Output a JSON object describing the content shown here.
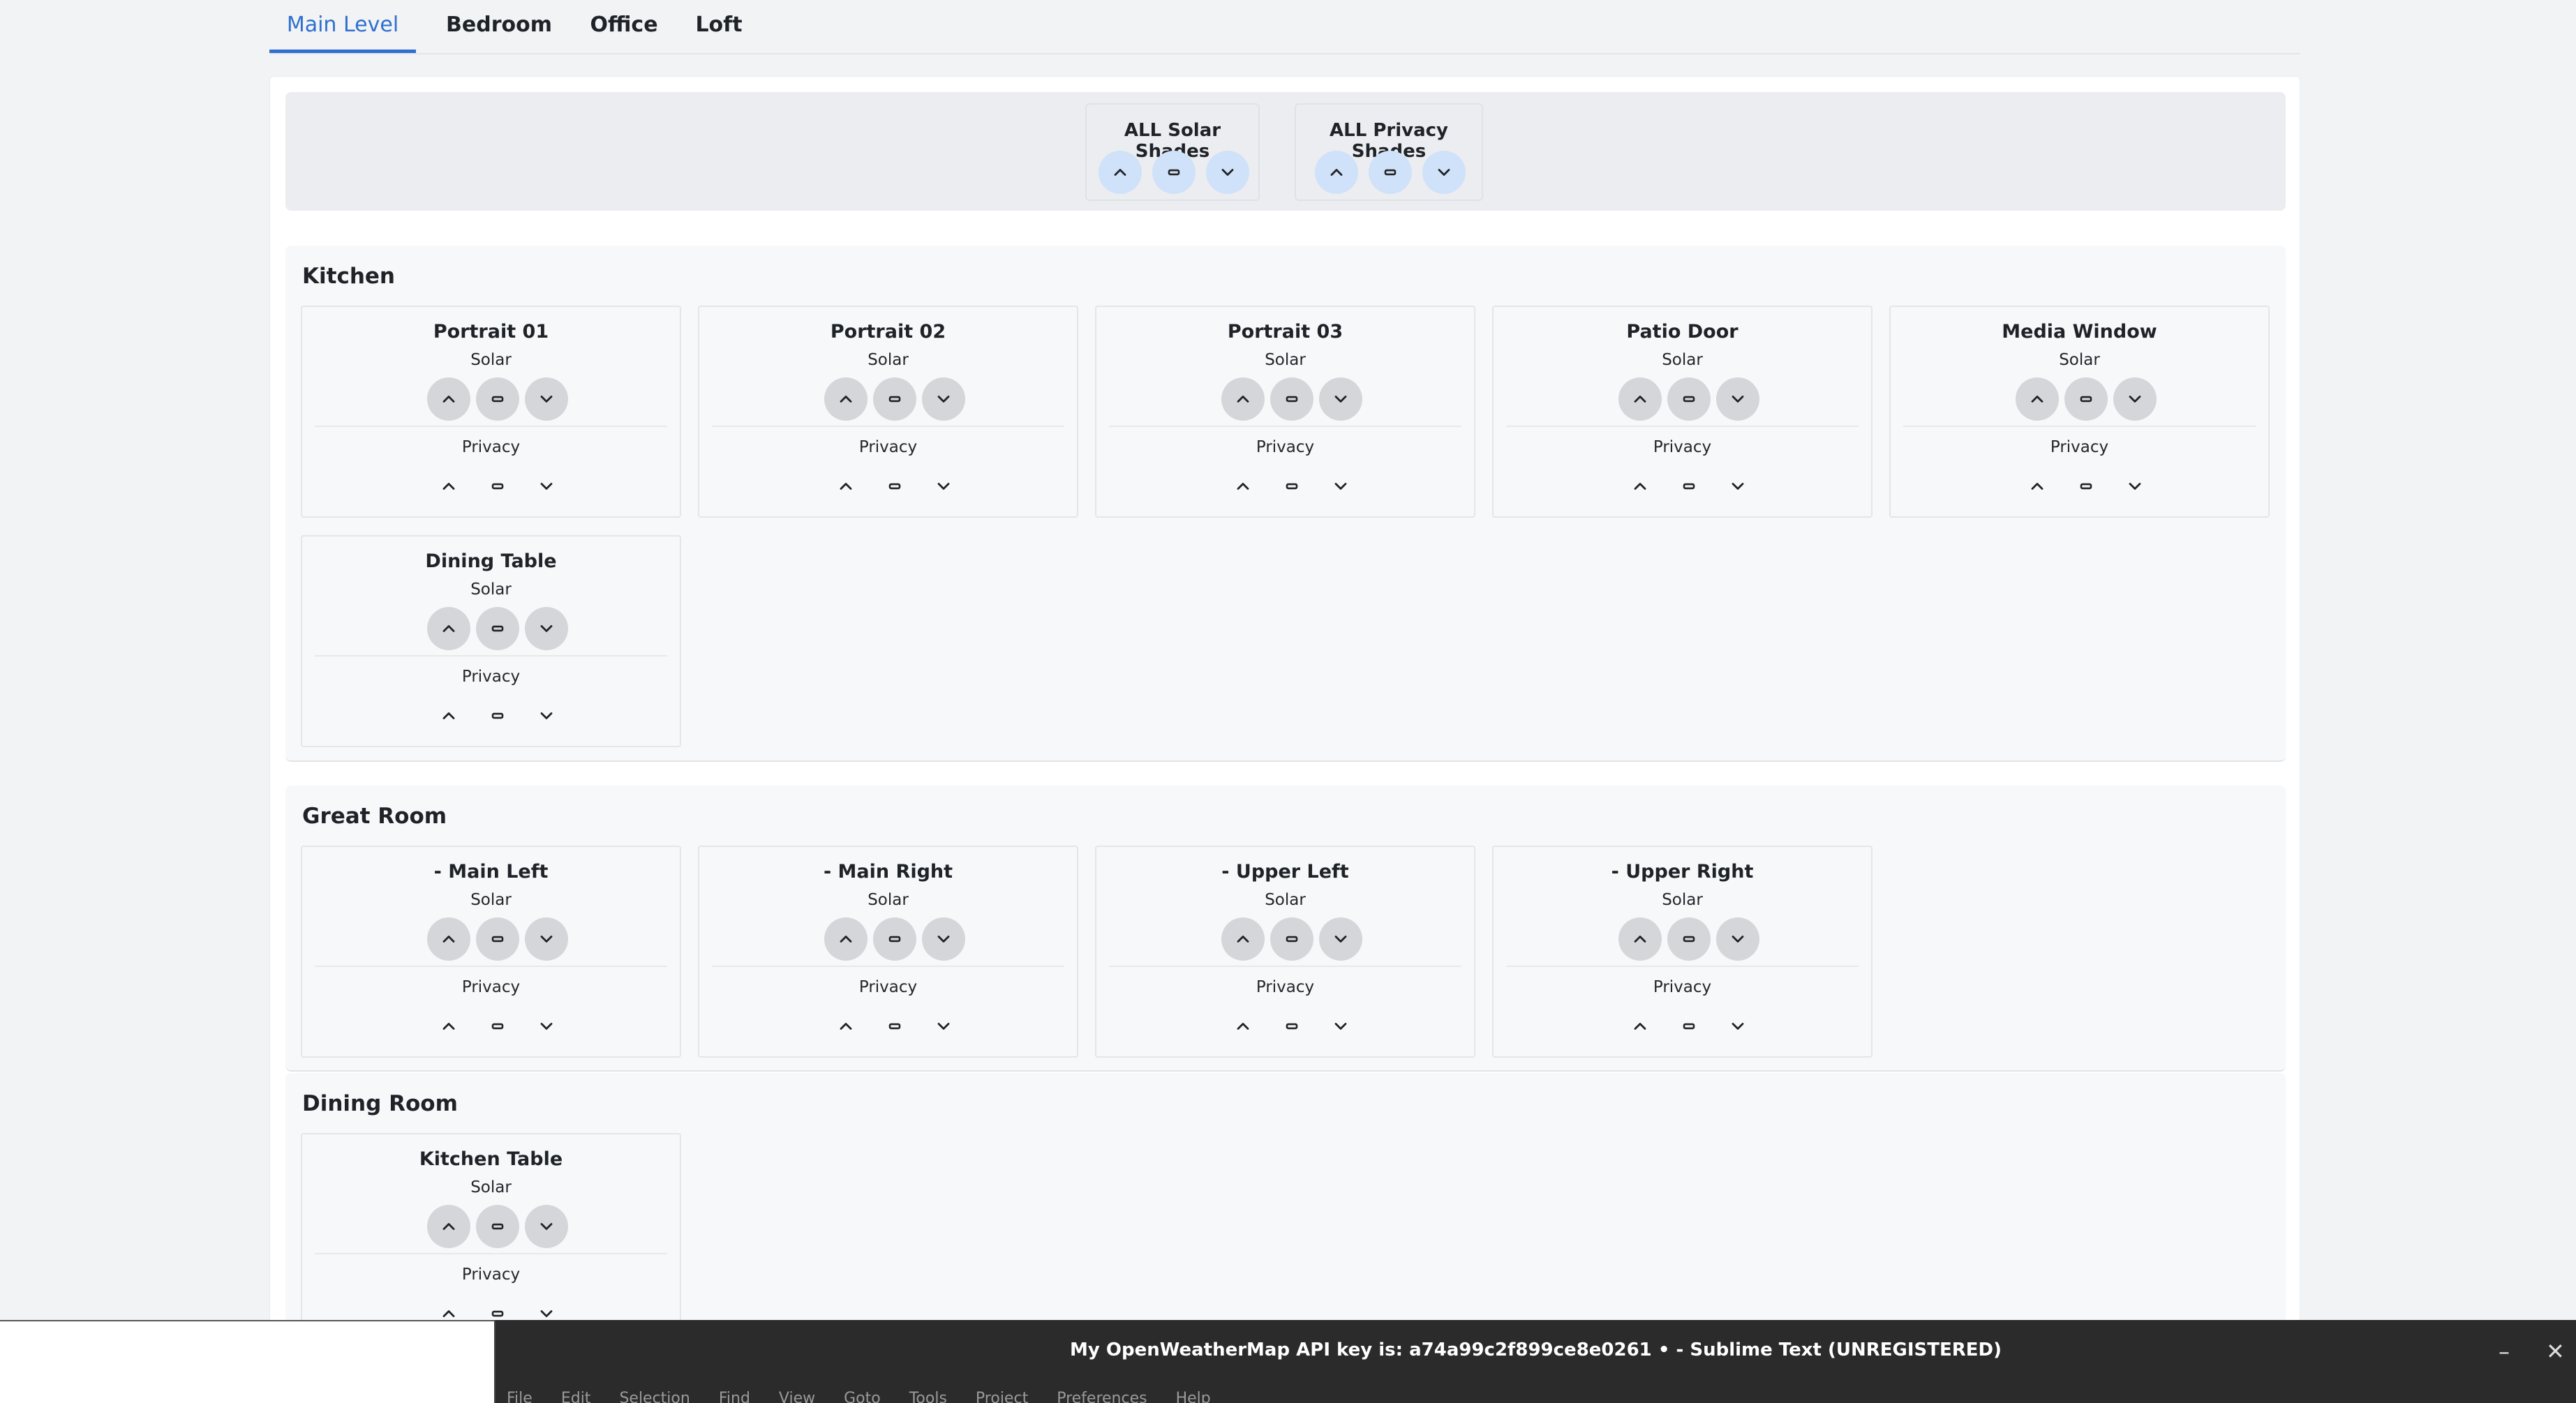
{
  "tabs": [
    {
      "label": "Main Level",
      "active": true
    },
    {
      "label": "Bedroom",
      "active": false
    },
    {
      "label": "Office",
      "active": false
    },
    {
      "label": "Loft",
      "active": false
    }
  ],
  "all_controls": {
    "solar_label": "ALL Solar Shades",
    "privacy_label": "ALL Privacy Shades"
  },
  "shade_labels": {
    "solar": "Solar",
    "privacy": "Privacy"
  },
  "icons": {
    "up": "chevron-up-icon",
    "stop": "stop-icon",
    "down": "chevron-down-icon"
  },
  "colors": {
    "accent": "#2f6fcf",
    "all_button": "#cfe2fa",
    "solar_button": "#d4d6da"
  },
  "rooms": [
    {
      "name": "Kitchen",
      "windows": [
        "Portrait 01",
        "Portrait 02",
        "Portrait 03",
        "Patio Door",
        "Media Window",
        "Dining Table"
      ]
    },
    {
      "name": "Great Room",
      "windows": [
        "- Main Left",
        "- Main Right",
        "- Upper Left",
        "- Upper Right"
      ]
    },
    {
      "name": "Dining Room",
      "windows": [
        "Kitchen Table"
      ]
    }
  ],
  "sublime": {
    "title": "My OpenWeatherMap API key is: a74a99c2f899ce8e0261 • - Sublime Text (UNREGISTERED)",
    "minimize": "–",
    "close": "✕",
    "menu": [
      "File",
      "Edit",
      "Selection",
      "Find",
      "View",
      "Goto",
      "Tools",
      "Project",
      "Preferences",
      "Help"
    ]
  }
}
